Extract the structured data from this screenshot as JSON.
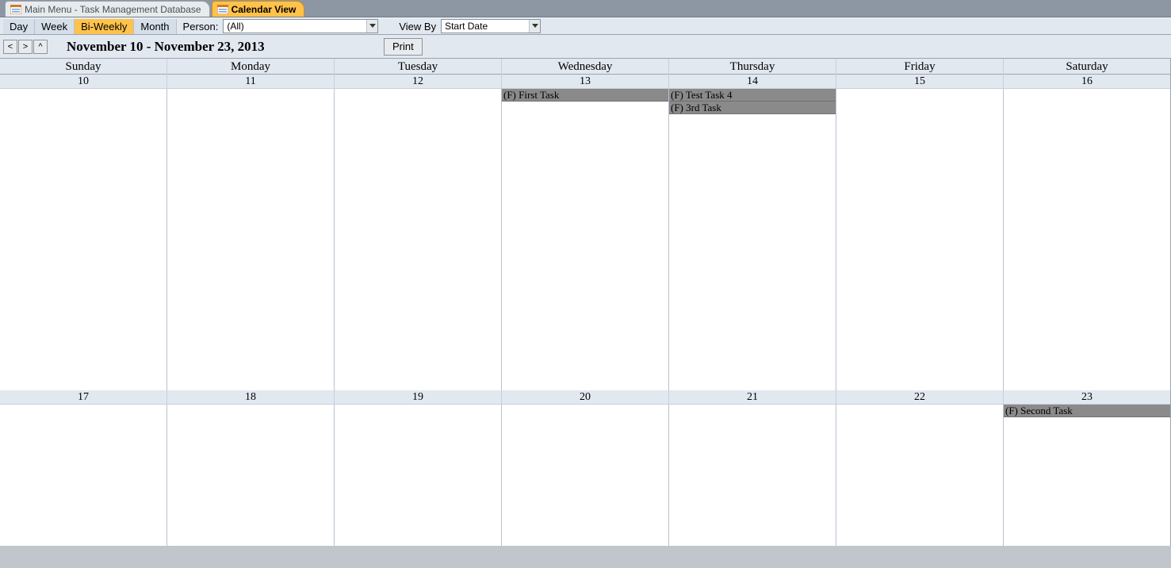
{
  "tabs": [
    {
      "label": "Main Menu - Task Management Database",
      "active": false
    },
    {
      "label": "Calendar View",
      "active": true
    }
  ],
  "toolbar": {
    "views": {
      "day": "Day",
      "week": "Week",
      "biweekly": "Bi-Weekly",
      "month": "Month"
    },
    "active_view": "biweekly",
    "person_label": "Person:",
    "person_value": "(All)",
    "viewby_label": "View By",
    "viewby_value": "Start Date"
  },
  "nav": {
    "prev": "<",
    "next": ">",
    "up": "^",
    "date_range": "November 10 - November 23, 2013",
    "print": "Print"
  },
  "day_names": [
    "Sunday",
    "Monday",
    "Tuesday",
    "Wednesday",
    "Thursday",
    "Friday",
    "Saturday"
  ],
  "weeks": [
    {
      "dates": [
        "10",
        "11",
        "12",
        "13",
        "14",
        "15",
        "16"
      ],
      "tasks": {
        "3": [
          "(F) First Task"
        ],
        "4": [
          "(F) Test Task 4",
          "(F) 3rd Task"
        ]
      }
    },
    {
      "dates": [
        "17",
        "18",
        "19",
        "20",
        "21",
        "22",
        "23"
      ],
      "tasks": {
        "6": [
          "(F) Second Task"
        ]
      }
    }
  ]
}
